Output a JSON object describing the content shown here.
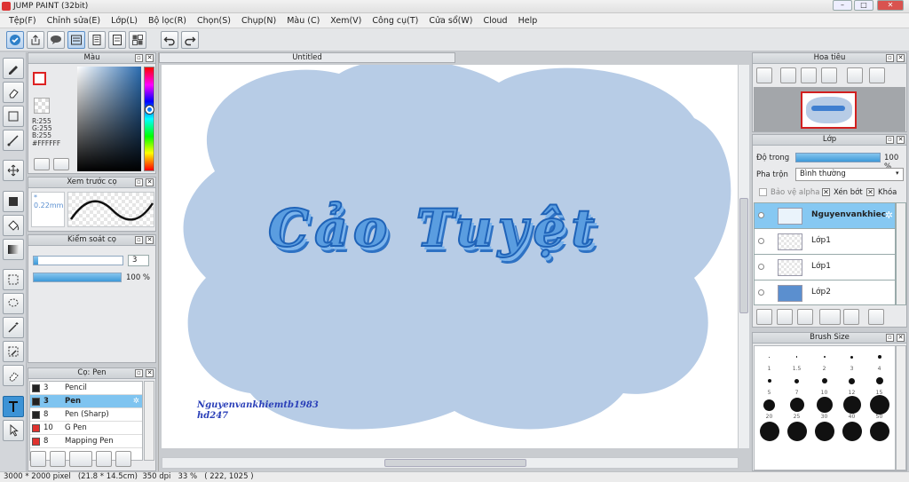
{
  "window": {
    "title": "JUMP PAINT (32bit)"
  },
  "menu": [
    "Tệp(F)",
    "Chỉnh sửa(E)",
    "Lớp(L)",
    "Bộ lọc(R)",
    "Chọn(S)",
    "Chụp(N)",
    "Màu (C)",
    "Xem(V)",
    "Công cụ(T)",
    "Cửa sổ(W)",
    "Cloud",
    "Help"
  ],
  "color_panel": {
    "title": "Màu",
    "r": "R:255",
    "g": "G:255",
    "b": "B:255",
    "hex": "#FFFFFF",
    "fg_color": "#FFFFFF"
  },
  "preview_panel": {
    "title": "Xem trước cọ",
    "size": "* 0.22mm"
  },
  "control_panel": {
    "title": "Kiểm soát cọ",
    "size_value": "3",
    "size_fraction": 0.05,
    "opacity_value": "100 %",
    "opacity_fraction": 1.0
  },
  "pen_panel": {
    "title": "Cọ: Pen",
    "items": [
      {
        "num": "3",
        "name": "Pencil",
        "color": "#222222",
        "selected": false
      },
      {
        "num": "3",
        "name": "Pen",
        "color": "#222222",
        "selected": true
      },
      {
        "num": "8",
        "name": "Pen (Sharp)",
        "color": "#222222",
        "selected": false
      },
      {
        "num": "10",
        "name": "G Pen",
        "color": "#e0322e",
        "selected": false
      },
      {
        "num": "8",
        "name": "Mapping Pen",
        "color": "#e0322e",
        "selected": false
      }
    ]
  },
  "document": {
    "tab": "Untitled",
    "lettering": "Cảo Tuyệt",
    "signature_line1": "Nguyenvankhiemtb1983",
    "signature_line2": "hd247"
  },
  "navigator": {
    "title": "Hoa tiêu"
  },
  "layer_panel": {
    "title": "Lớp",
    "opacity_label": "Độ trong",
    "opacity_value": "100 %",
    "blend_label": "Pha trộn",
    "blend_value": "Bình thường",
    "protect_alpha": "Bảo vệ alpha",
    "clip": "Xén bớt",
    "lock": "Khóa",
    "layers": [
      {
        "name": "Nguyenvankhiec",
        "selected": true
      },
      {
        "name": "Lớp1",
        "selected": false
      },
      {
        "name": "Lớp1",
        "selected": false
      },
      {
        "name": "Lớp2",
        "selected": false
      }
    ]
  },
  "brush_size": {
    "title": "Brush Size",
    "labels": [
      "1",
      "1.5",
      "2",
      "3",
      "4",
      "5",
      "7",
      "10",
      "12",
      "15",
      "20",
      "25",
      "30",
      "40",
      "50"
    ]
  },
  "status": {
    "text": "3000 * 2000 pixel   (21.8 * 14.5cm)  350 dpi   33 %   ( 222, 1025 )"
  },
  "colors": {
    "accent": "#3d93d6",
    "selection": "#86c8f2",
    "cloud": "#b7cce6",
    "lettering": "#3f7fd0"
  }
}
